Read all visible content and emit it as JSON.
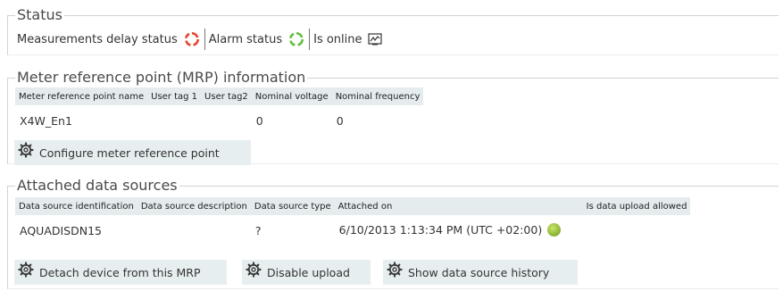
{
  "status": {
    "title": "Status",
    "measurements_delay_label": "Measurements delay status",
    "measurements_delay_color": "#e8422f",
    "alarm_label": "Alarm status",
    "alarm_color": "#5fbf3a",
    "online_label": "Is online"
  },
  "mrp": {
    "title": "Meter reference point (MRP) information",
    "columns": [
      "Meter reference point name",
      "User tag 1",
      "User tag2",
      "Nominal voltage",
      "Nominal frequency"
    ],
    "row": [
      "X4W_En1",
      "",
      "",
      "0",
      "0"
    ],
    "configure_label": "Configure meter reference point"
  },
  "sources": {
    "title": "Attached data sources",
    "columns": [
      "Data source identification",
      "Data source description",
      "Data source type",
      "Attached on",
      "Is data upload allowed"
    ],
    "row": [
      "AQUADISDN15",
      "",
      "?",
      "6/10/2013 1:13:34 PM (UTC +02:00)",
      ""
    ],
    "upload_allowed_color": "#8ab832",
    "detach_label": "Detach device from this MRP",
    "disable_label": "Disable upload",
    "history_label": "Show data source history"
  }
}
